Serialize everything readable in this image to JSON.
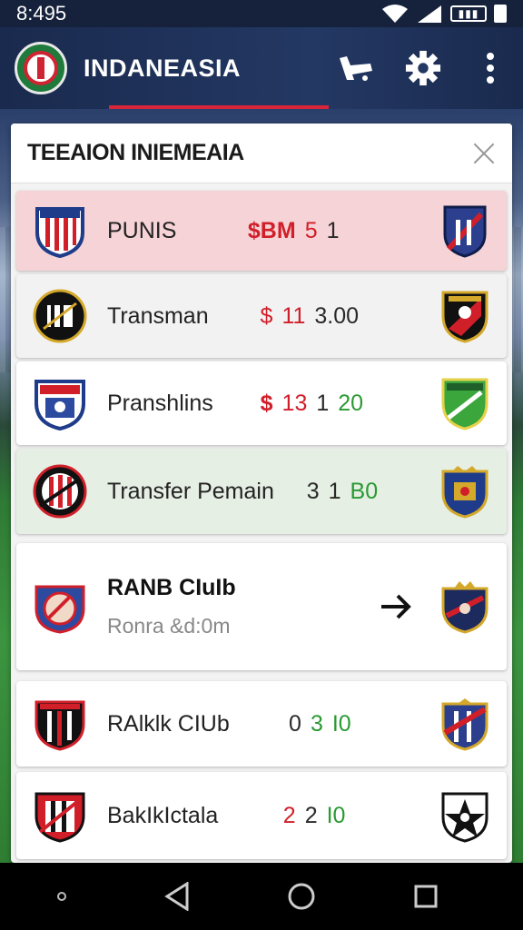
{
  "status_bar": {
    "time": "8:495"
  },
  "app_bar": {
    "title": "INDANEASIA"
  },
  "panel": {
    "title": "TEEAION INIEMEAIA"
  },
  "rows": [
    {
      "name": "PUNIS",
      "prefix": "$BM",
      "a": "5",
      "b": "1",
      "highlight": "#f6d3d7"
    },
    {
      "name": "Transman",
      "prefix": "$",
      "a": "11",
      "b": "3.00",
      "highlight": "#f2f2f2"
    },
    {
      "name": "Pranshlins",
      "prefix": "$",
      "a": "13",
      "b": "1",
      "c": "20",
      "highlight": "#ffffff"
    },
    {
      "name": "Transfer Pemain",
      "a": "3",
      "b": "1",
      "c": "B0",
      "highlight": "#e6efe3"
    },
    {
      "name": "RANB CIuIb",
      "subtitle": "Ronra &d:0m",
      "highlight": "#ffffff"
    },
    {
      "name": "RAlklk CIUb",
      "a": "0",
      "b": "3",
      "c": "I0",
      "highlight": "#ffffff"
    },
    {
      "name": "BakIkIctala",
      "a": "2",
      "b": "2",
      "c": "I0",
      "highlight": "#ffffff"
    }
  ],
  "colors": {
    "accent": "#d8253a",
    "appbar": "#1a2a4e",
    "win": "#2a9a33",
    "loss": "#d11f2a"
  },
  "icons": [
    "signal-icon",
    "battery-icon",
    "shop-icon",
    "gear-icon",
    "more-icon",
    "close-icon",
    "arrow-right-icon",
    "back-icon",
    "home-icon",
    "recents-icon"
  ]
}
